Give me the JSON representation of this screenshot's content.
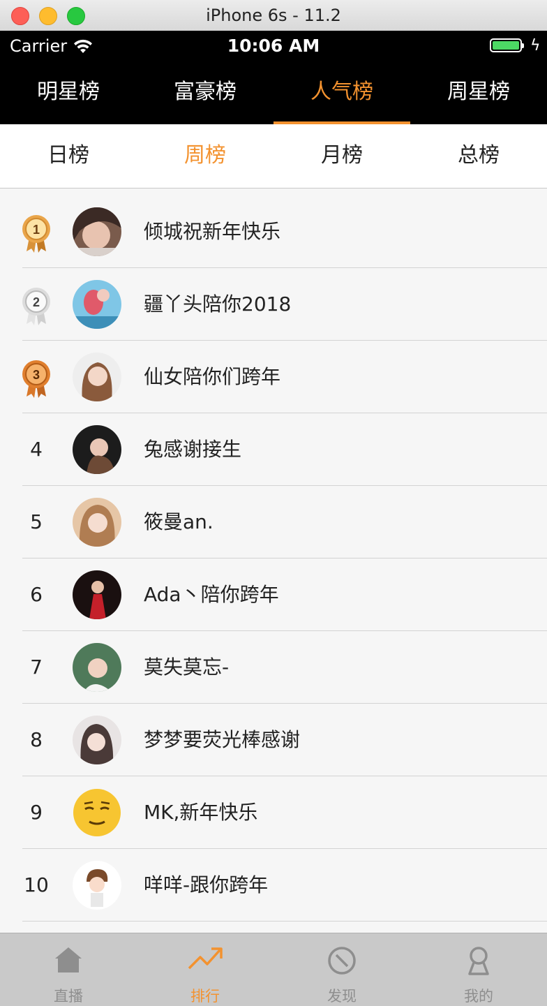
{
  "window": {
    "title": "iPhone 6s - 11.2"
  },
  "status_bar": {
    "carrier": "Carrier",
    "time": "10:06 AM"
  },
  "main_tabs": [
    {
      "label": "明星榜",
      "active": false
    },
    {
      "label": "富豪榜",
      "active": false
    },
    {
      "label": "人气榜",
      "active": true
    },
    {
      "label": "周星榜",
      "active": false
    }
  ],
  "sub_tabs": [
    {
      "label": "日榜",
      "active": false
    },
    {
      "label": "周榜",
      "active": true
    },
    {
      "label": "月榜",
      "active": false
    },
    {
      "label": "总榜",
      "active": false
    }
  ],
  "ranking": [
    {
      "rank": "1",
      "medal": "gold-medal-icon",
      "name": "倾城祝新年快乐"
    },
    {
      "rank": "2",
      "medal": "silver-medal-icon",
      "name": "疆丫头陪你2018"
    },
    {
      "rank": "3",
      "medal": "bronze-medal-icon",
      "name": "仙女陪你们跨年"
    },
    {
      "rank": "4",
      "name": "兔感谢接生"
    },
    {
      "rank": "5",
      "name": "筱曼an."
    },
    {
      "rank": "6",
      "name": "Ada丶陪你跨年"
    },
    {
      "rank": "7",
      "name": "莫失莫忘-"
    },
    {
      "rank": "8",
      "name": "梦梦要荧光棒感谢"
    },
    {
      "rank": "9",
      "name": "MK,新年快乐"
    },
    {
      "rank": "10",
      "name": "咩咩-跟你跨年"
    }
  ],
  "bottom_tabs": [
    {
      "label": "直播",
      "icon": "home-icon",
      "active": false
    },
    {
      "label": "排行",
      "icon": "trending-up-icon",
      "active": true
    },
    {
      "label": "发现",
      "icon": "compass-icon",
      "active": false
    },
    {
      "label": "我的",
      "icon": "profile-icon",
      "active": false
    }
  ],
  "colors": {
    "accent": "#f3922f",
    "header_bg": "#000000",
    "list_bg": "#f6f6f6",
    "tab_inactive": "#8e8e8e"
  }
}
